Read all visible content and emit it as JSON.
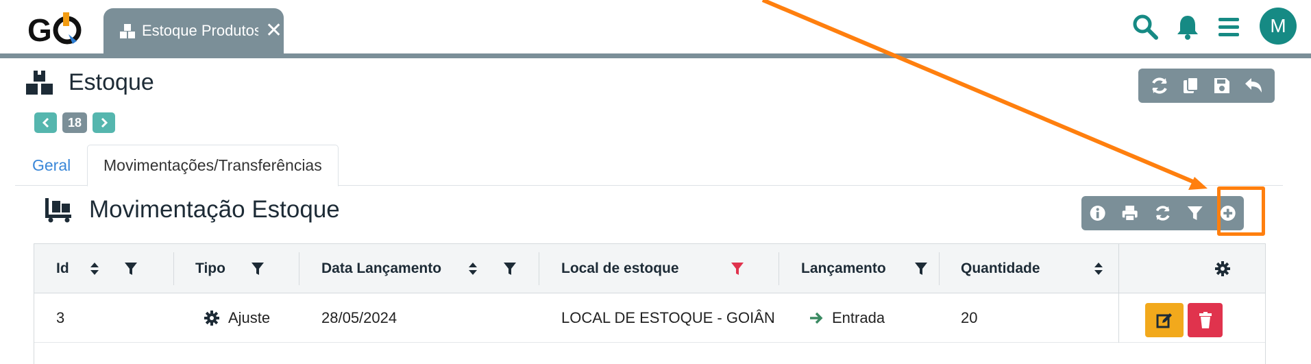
{
  "app": {
    "logo_text": "GO"
  },
  "tab": {
    "label": "Estoque Produtos",
    "close": "✕"
  },
  "user": {
    "avatar_initial": "M"
  },
  "page": {
    "title": "Estoque"
  },
  "pager": {
    "count": "18"
  },
  "subtabs": {
    "general": "Geral",
    "movements": "Movimentações/Transferências"
  },
  "section": {
    "title": "Movimentação Estoque"
  },
  "table": {
    "columns": {
      "id": "Id",
      "tipo": "Tipo",
      "data": "Data Lançamento",
      "local": "Local de estoque",
      "lancamento": "Lançamento",
      "quantidade": "Quantidade"
    },
    "rows": [
      {
        "id": "3",
        "tipo": "Ajuste",
        "data": "28/05/2024",
        "local": "LOCAL DE ESTOQUE - GOIÂN",
        "lancamento": "Entrada",
        "quantidade": "20"
      }
    ]
  },
  "colors": {
    "accent": "#168a84",
    "toolbar": "#7b8f98",
    "annotation": "#ff7f0e",
    "edit": "#f2a91c",
    "delete": "#e0334d",
    "active_filter": "#e0334d"
  },
  "icons": [
    "search-icon",
    "bell-icon",
    "menu-icon",
    "refresh-icon",
    "copy-icon",
    "save-icon",
    "undo-icon",
    "info-icon",
    "print-icon",
    "filter-icon",
    "add-circle-icon",
    "gear-icon",
    "edit-icon",
    "trash-icon",
    "arrow-right-icon",
    "boxes-icon",
    "pallet-cart-icon"
  ]
}
